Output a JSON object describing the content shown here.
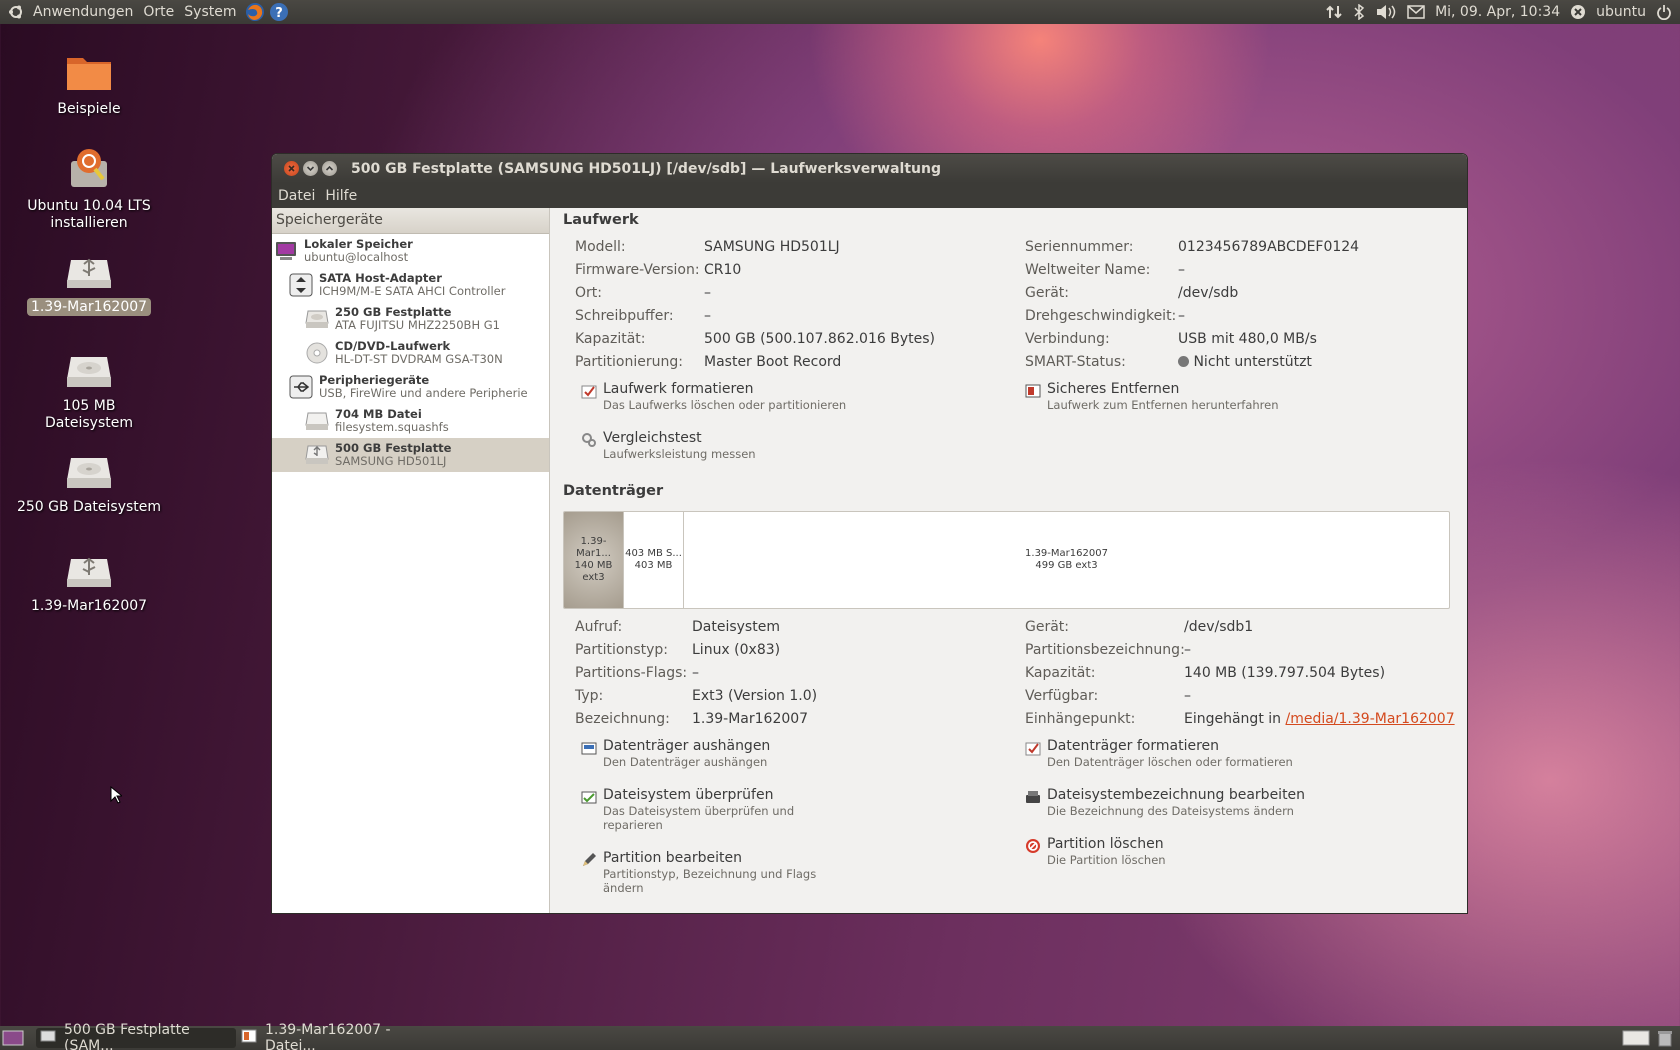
{
  "top_panel": {
    "menus": [
      "Anwendungen",
      "Orte",
      "System"
    ],
    "clock": "Mi, 09. Apr, 10:34",
    "user": "ubuntu"
  },
  "desktop": {
    "icons": [
      {
        "label": "Beispiele",
        "icon": "folder-icon"
      },
      {
        "label": "Ubuntu 10.04 LTS installieren",
        "icon": "ubuntu-installer-icon"
      },
      {
        "label": "1.39-Mar162007",
        "icon": "usb-drive-icon",
        "selected": true
      },
      {
        "label": "105 MB Dateisystem",
        "icon": "hard-disk-icon"
      },
      {
        "label": "250 GB Dateisystem",
        "icon": "hard-disk-icon"
      },
      {
        "label": "1.39-Mar162007",
        "icon": "usb-drive-icon"
      }
    ]
  },
  "window": {
    "title": "500 GB Festplatte (SAMSUNG HD501LJ) [/dev/sdb] — Laufwerksverwaltung",
    "menu": [
      "Datei",
      "Hilfe"
    ],
    "sidebar": {
      "header": "Speichergeräte",
      "items": [
        {
          "title": "Lokaler Speicher",
          "sub": "ubuntu@localhost",
          "icon": "computer-icon"
        },
        {
          "title": "SATA Host-Adapter",
          "sub": "ICH9M/M-E SATA AHCI Controller",
          "icon": "sata-adapter-icon"
        },
        {
          "title": "250 GB Festplatte",
          "sub": "ATA FUJITSU MHZ2250BH G1",
          "icon": "hard-disk-icon"
        },
        {
          "title": "CD/DVD-Laufwerk",
          "sub": "HL-DT-ST DVDRAM GSA-T30N",
          "icon": "optical-drive-icon"
        },
        {
          "title": "Peripheriegeräte",
          "sub": "USB, FireWire und andere Peripherie",
          "icon": "usb-adapter-icon"
        },
        {
          "title": "704 MB Datei",
          "sub": "filesystem.squashfs",
          "icon": "file-disk-icon"
        },
        {
          "title": "500 GB Festplatte",
          "sub": "SAMSUNG HD501LJ",
          "icon": "usb-disk-icon",
          "selected": true
        }
      ]
    },
    "drive": {
      "heading": "Laufwerk",
      "left": [
        [
          "Modell:",
          "SAMSUNG HD501LJ"
        ],
        [
          "Firmware-Version:",
          "CR10"
        ],
        [
          "Ort:",
          "–"
        ],
        [
          "Schreibpuffer:",
          "–"
        ],
        [
          "Kapazität:",
          "500 GB (500.107.862.016 Bytes)"
        ],
        [
          "Partitionierung:",
          "Master Boot Record"
        ]
      ],
      "right": [
        [
          "Seriennummer:",
          "0123456789ABCDEF0124"
        ],
        [
          "Weltweiter Name:",
          "–"
        ],
        [
          "Gerät:",
          "/dev/sdb"
        ],
        [
          "Drehgeschwindigkeit:",
          "–"
        ],
        [
          "Verbindung:",
          "USB mit 480,0 MB/s"
        ],
        [
          "SMART-Status:",
          "Nicht unterstützt"
        ]
      ],
      "actions": [
        {
          "title": "Laufwerk formatieren",
          "desc": "Das Laufwerks löschen oder partitionieren"
        },
        {
          "title": "Sicheres Entfernen",
          "desc": "Laufwerk zum Entfernen herunterfahren"
        },
        {
          "title": "Vergleichstest",
          "desc": "Laufwerksleistung messen"
        }
      ]
    },
    "volumes": {
      "heading": "Datenträger",
      "segments": [
        {
          "line1": "1.39-Mar1...",
          "line2": "140 MB ext3"
        },
        {
          "line1": "403 MB S...",
          "line2": "403 MB"
        },
        {
          "line1": "1.39-Mar162007",
          "line2": "499 GB ext3"
        }
      ],
      "left": [
        [
          "Aufruf:",
          "Dateisystem"
        ],
        [
          "Partitionstyp:",
          "Linux (0x83)"
        ],
        [
          "Partitions-Flags:",
          "–"
        ],
        [
          "Typ:",
          "Ext3 (Version 1.0)"
        ],
        [
          "Bezeichnung:",
          "1.39-Mar162007"
        ]
      ],
      "right": [
        [
          "Gerät:",
          "/dev/sdb1"
        ],
        [
          "Partitionsbezeichnung:",
          "–"
        ],
        [
          "Kapazität:",
          "140 MB (139.797.504 Bytes)"
        ],
        [
          "Verfügbar:",
          "–"
        ],
        [
          "Einhängepunkt:",
          "Eingehängt in"
        ]
      ],
      "mount_link": "/media/1.39-Mar162007",
      "actions": [
        {
          "title": "Datenträger aushängen",
          "desc": "Den Datenträger aushängen"
        },
        {
          "title": "Datenträger formatieren",
          "desc": "Den Datenträger löschen oder formatieren"
        },
        {
          "title": "Dateisystem überprüfen",
          "desc1": "Das Dateisystem überprüfen und",
          "desc2": "reparieren"
        },
        {
          "title": "Dateisystembezeichnung bearbeiten",
          "desc": "Die Bezeichnung des Dateisystems ändern"
        },
        {
          "title": "Partition bearbeiten",
          "desc1": "Partitionstyp, Bezeichnung und Flags",
          "desc2": "ändern"
        },
        {
          "title": "Partition löschen",
          "desc": "Die Partition löschen"
        }
      ]
    }
  },
  "taskbar": {
    "tasks": [
      "500 GB Festplatte (SAM...",
      "1.39-Mar162007 - Datei..."
    ]
  }
}
